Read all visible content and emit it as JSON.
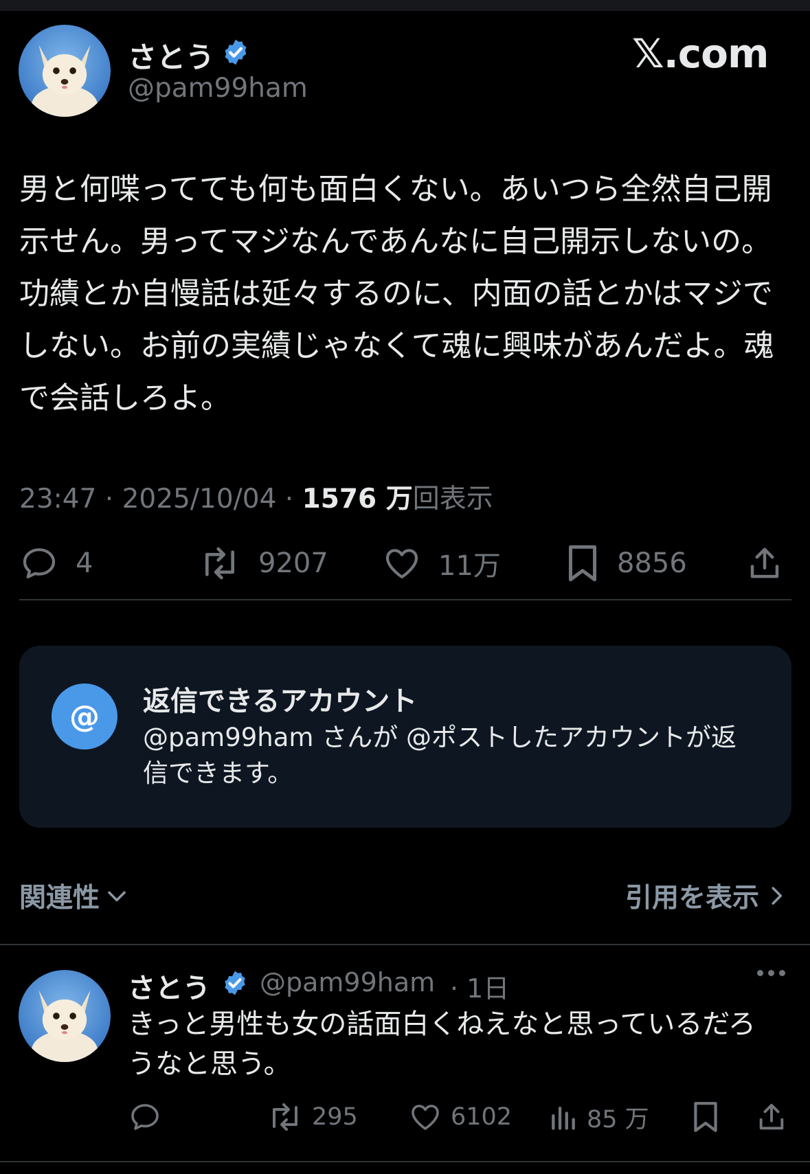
{
  "main_post": {
    "display_name": "さとう",
    "handle": "@pam99ham",
    "brand": "𝕏.com",
    "text": "男と何喋ってても何も面白くない。あいつら全然自己開示せん。男ってマジなんであんなに自己開示しないの。功績とか自慢話は延々するのに、内面の話とかはマジでしない。お前の実績じゃなくて魂に興味があんだよ。魂で会話しろよ。",
    "time": "23:47",
    "date": "2025/10/04",
    "sep": " · ",
    "views_number": "1576 万",
    "views_label": "回表示",
    "replies": "4",
    "reposts": "9207",
    "likes": "11万",
    "bookmarks": "8856"
  },
  "reply_settings": {
    "icon": "@",
    "title": "返信できるアカウント",
    "description": "@pam99ham さんが @ポストしたアカウントが返信できます。"
  },
  "sort": {
    "label": "関連性",
    "quotes_label": "引用を表示"
  },
  "reply_post": {
    "display_name": "さとう",
    "handle": "@pam99ham",
    "time": "· 1日",
    "text": "きっと男性も女の話面白くねえなと思っているだろうなと思う。",
    "replies": "",
    "reposts": "295",
    "likes": "6102",
    "views": "85 万"
  },
  "colors": {
    "background": "#000000",
    "verified_blue": "#4a99e9",
    "muted": "#71767b",
    "text": "#e7e9ea",
    "card": "#0e1621"
  },
  "icons": [
    "avatar",
    "verified-badge-icon",
    "reply-icon",
    "repost-icon",
    "like-icon",
    "bookmark-icon",
    "share-icon",
    "views-icon",
    "more-icon",
    "chevron-down-icon",
    "chevron-right-icon"
  ]
}
